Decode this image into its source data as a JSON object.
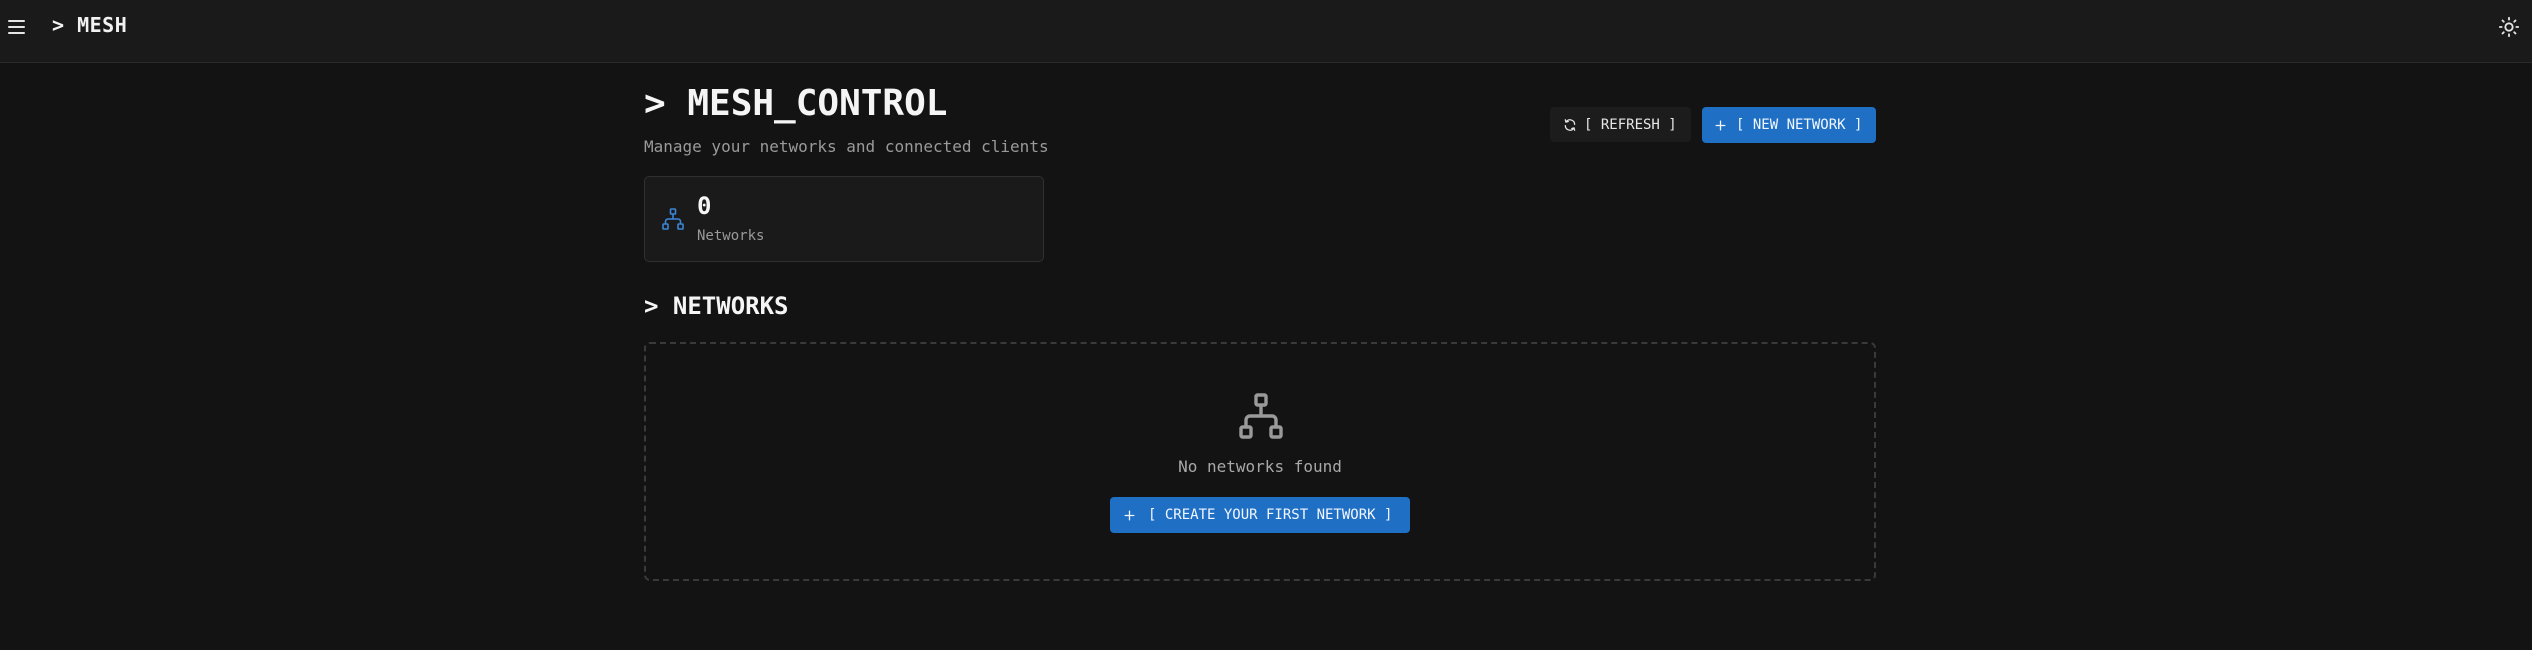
{
  "header": {
    "brand": "> MESH"
  },
  "page": {
    "title": "> MESH_CONTROL",
    "subtitle": "Manage your networks and connected clients"
  },
  "actions": {
    "refresh_label": "[ REFRESH ]",
    "new_network_label": "[ NEW NETWORK ]"
  },
  "stats": {
    "networks_count": "0",
    "networks_label": "Networks"
  },
  "networks_section": {
    "title": "> NETWORKS",
    "empty_message": "No networks found",
    "create_label": "[ CREATE YOUR FIRST NETWORK ]"
  },
  "icons": {
    "menu": "hamburger-menu-icon",
    "theme": "sun-icon",
    "refresh": "refresh-icon",
    "add": "plus-icon",
    "network": "network-icon"
  },
  "colors": {
    "background": "#131313",
    "header_bg": "#1a1a1a",
    "accent": "#1f6fc5",
    "stat_icon": "#3b86d6",
    "muted_text": "#9a9a9a"
  }
}
